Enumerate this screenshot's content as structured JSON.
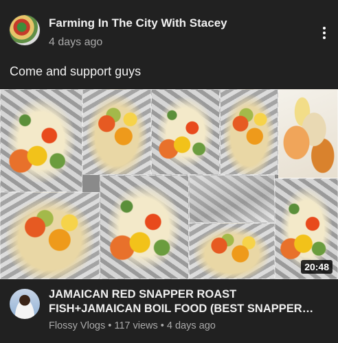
{
  "post": {
    "channel_name": "Farming In The City With Stacey",
    "time_ago": "4 days ago",
    "text": "Come and support guys"
  },
  "video": {
    "duration": "20:48",
    "title": "JAMAICAN RED SNAPPER ROAST FISH+JAMAICAN BOIL FOOD (BEST SNAPPER FISH RECIPE) JAMAICAN STYLE",
    "uploader": "Flossy Vlogs",
    "views": "117 views",
    "time_ago": "4 days ago",
    "separator": "•"
  },
  "icons": {
    "menu": "more-vert-icon"
  },
  "colors": {
    "background": "#212121",
    "primary_text": "#f1f1f1",
    "secondary_text": "#aaaaaa"
  }
}
